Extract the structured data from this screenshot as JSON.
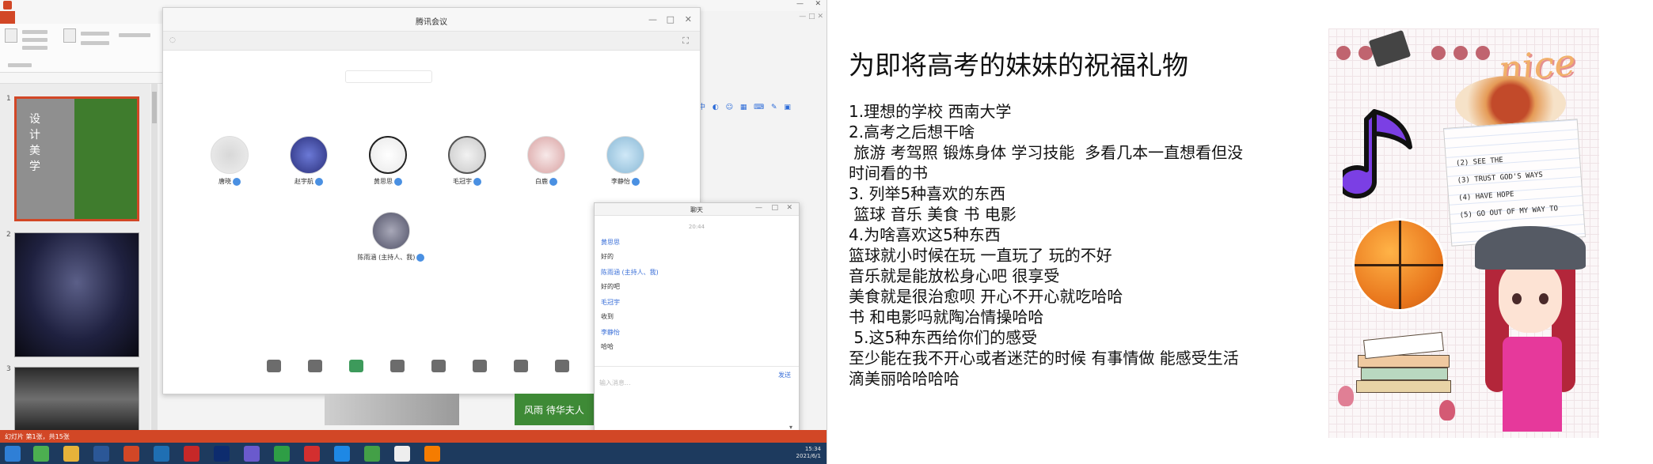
{
  "screenshot": {
    "app_title": "Microsoft PowerPoint",
    "meeting_title": "腾讯会议",
    "participants": [
      {
        "name": "唐晓"
      },
      {
        "name": "赵宇航"
      },
      {
        "name": "黄思思"
      },
      {
        "name": "毛冠宇"
      },
      {
        "name": "白鹿"
      },
      {
        "name": "李静怡"
      },
      {
        "name": "陈雨涵 (主持人、我)"
      }
    ],
    "chat": {
      "title": "聊天",
      "time": "20:44",
      "send_label": "发送",
      "input_placeholder": "输入消息...",
      "lines": [
        {
          "text": "黄思思",
          "style": "blue"
        },
        {
          "text": "好的",
          "style": "dark"
        },
        {
          "text": "陈雨涵 (主持人、我)",
          "style": "blue"
        },
        {
          "text": "好的吧",
          "style": "dark"
        },
        {
          "text": "毛冠宇",
          "style": "blue"
        },
        {
          "text": "收到",
          "style": "dark"
        },
        {
          "text": "李静怡",
          "style": "blue"
        },
        {
          "text": "哈哈",
          "style": "dark"
        }
      ]
    },
    "thumb1_text": [
      "设",
      "计",
      "美",
      "学"
    ],
    "peek_text": "风雨  待华夫人",
    "status": "幻灯片 第1张，共15张",
    "tray": [
      "15:34",
      "2021/6/1"
    ]
  },
  "content": {
    "title": "为即将高考的妹妹的祝福礼物",
    "lines": [
      "1.理想的学校 西南大学",
      "2.高考之后想干啥",
      " 旅游 考驾照 锻炼身体 学习技能  多看几本一直想看但没",
      "时间看的书",
      "3. 列举5种喜欢的东西",
      " 篮球 音乐 美食 书 电影",
      "4.为啥喜欢这5种东西",
      "篮球就小时候在玩 一直玩了 玩的不好",
      "音乐就是能放松身心吧 很享受",
      "美食就是很治愈呗 开心不开心就吃哈哈",
      "书 和电影吗就陶冶情操哈哈",
      " 5.这5种东西给你们的感受",
      "至少能在我不开心或者迷茫的时候 有事情做 能感受生活",
      "滴美丽哈哈哈哈"
    ]
  },
  "collage": {
    "hice": "nice",
    "note_lines": [
      "(2) SEE THE",
      "(3) TRUST GOD'S WAYS",
      "(4) HAVE HOPE",
      "(5) GO OUT OF MY WAY TO"
    ]
  },
  "colors": {
    "ppt_accent": "#d24726",
    "chat_blue": "#3a6fd8",
    "taskbar": "#1d3a5e"
  }
}
